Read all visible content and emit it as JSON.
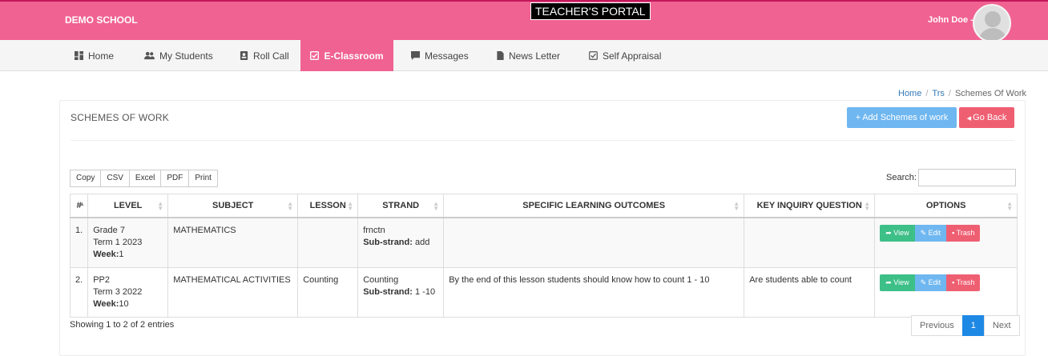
{
  "header": {
    "school_name": "DEMO SCHOOL",
    "portal_title": "TEACHER'S PORTAL",
    "user_name": "John Doe -",
    "brand_color": "#f06292"
  },
  "nav": {
    "items": [
      {
        "label": "Home",
        "icon": "dashboard-icon"
      },
      {
        "label": "My Students",
        "icon": "users-icon"
      },
      {
        "label": "Roll Call",
        "icon": "contact-card-icon"
      },
      {
        "label": "E-Classroom",
        "icon": "checkbox-icon",
        "active": true
      },
      {
        "label": "Messages",
        "icon": "message-icon"
      },
      {
        "label": "News Letter",
        "icon": "document-icon"
      },
      {
        "label": "Self Appraisal",
        "icon": "checkbox-icon"
      }
    ]
  },
  "breadcrumb": {
    "items": [
      "Home",
      "Trs",
      "Schemes Of Work"
    ],
    "separator": "/"
  },
  "panel": {
    "title": "SCHEMES OF WORK",
    "add_button": "Add Schemes of work",
    "add_icon": "+",
    "back_button": "Go Back",
    "back_icon": "◂"
  },
  "export_buttons": [
    "Copy",
    "CSV",
    "Excel",
    "PDF",
    "Print"
  ],
  "search": {
    "label": "Search:",
    "value": ""
  },
  "table": {
    "columns": [
      "#",
      "LEVEL",
      "SUBJECT",
      "LESSON",
      "STRAND",
      "SPECIFIC LEARNING OUTCOMES",
      "KEY INQUIRY QUESTION",
      "OPTIONS"
    ],
    "rows": [
      {
        "num": "1.",
        "level_grade": "Grade 7",
        "level_term": "Term 1 2023",
        "week_label": "Week:",
        "week": "1",
        "subject": "MATHEMATICS",
        "lesson": "",
        "strand": "frnctn",
        "substrand_label": "Sub-strand:",
        "substrand": "add",
        "outcomes": "",
        "inquiry": ""
      },
      {
        "num": "2.",
        "level_grade": "PP2",
        "level_term": "Term 3 2022",
        "week_label": "Week:",
        "week": "10",
        "subject": "MATHEMATICAL ACTIVITIES",
        "lesson": "Counting",
        "strand": "Counting",
        "substrand_label": "Sub-strand:",
        "substrand": "1 -10",
        "outcomes": "By the end of this lesson students should know how to count 1 - 10",
        "inquiry": "Are students able to count"
      }
    ],
    "option_labels": {
      "view": "View",
      "edit": "Edit",
      "trash": "Trash"
    }
  },
  "footer": {
    "showing": "Showing 1 to 2 of 2 entries",
    "pagination": {
      "previous": "Previous",
      "current": "1",
      "next": "Next"
    }
  }
}
